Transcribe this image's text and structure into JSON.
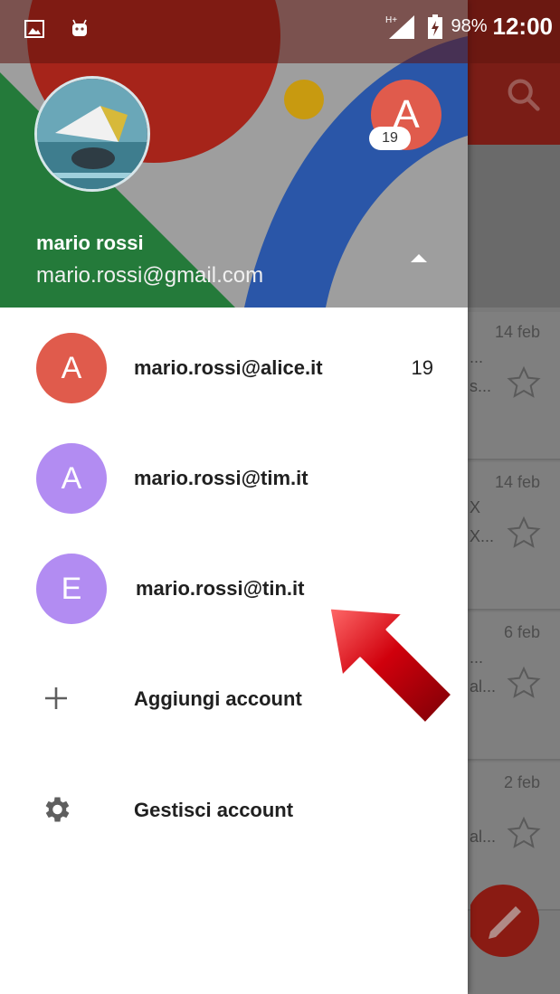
{
  "status_bar": {
    "network": "H+",
    "battery": "98%",
    "time": "12:00"
  },
  "drawer": {
    "header": {
      "name": "mario rossi",
      "email": "mario.rossi@gmail.com",
      "switch_avatar_letter": "A",
      "switch_badge": "19"
    },
    "accounts": [
      {
        "letter": "A",
        "email": "mario.rossi@alice.it",
        "count": "19",
        "color": "#e05b4c"
      },
      {
        "letter": "A",
        "email": "mario.rossi@tim.it",
        "count": "",
        "color": "#b28cf2"
      },
      {
        "letter": "E",
        "email": "mario.rossi@tin.it",
        "count": "",
        "color": "#b28cf2"
      }
    ],
    "actions": [
      {
        "label": "Aggiungi account",
        "icon": "plus-icon"
      },
      {
        "label": "Gestisci account",
        "icon": "gear-icon"
      }
    ]
  },
  "background_list": {
    "dates": [
      "14 feb",
      "14 feb",
      "6 feb",
      "2 feb"
    ],
    "snippets": [
      [
        "...",
        "s..."
      ],
      [
        "X",
        "X..."
      ],
      [
        "...",
        "al..."
      ],
      [
        "",
        "al..."
      ]
    ]
  },
  "colors": {
    "toolbar_red": "#7a1d16",
    "header_blue": "#2a56a8",
    "header_green": "#247a3a",
    "header_red": "#a6241a",
    "avatar_red": "#e05b4c",
    "avatar_purple": "#b28cf2",
    "arrow_red": "#c4000a"
  }
}
